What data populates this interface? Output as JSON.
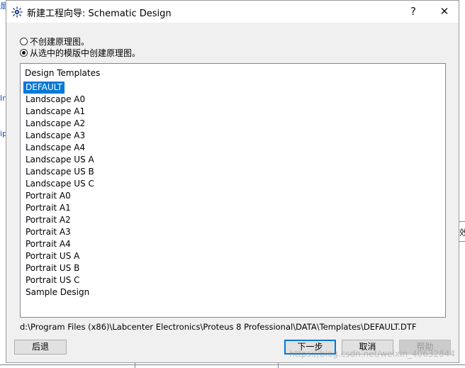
{
  "background": {
    "left_frags": [
      "是",
      "Ir",
      "ip"
    ],
    "right_cell": "效"
  },
  "dialog": {
    "title": "新建工程向导: Schematic Design",
    "help_glyph": "?",
    "close_glyph": "✕",
    "radio_options": [
      {
        "label": "不创建原理图。",
        "checked": false
      },
      {
        "label": "从选中的模版中创建原理图。",
        "checked": true
      }
    ],
    "list_header": "Design Templates",
    "templates": [
      "DEFAULT",
      "Landscape A0",
      "Landscape A1",
      "Landscape A2",
      "Landscape A3",
      "Landscape A4",
      "Landscape US A",
      "Landscape US B",
      "Landscape US C",
      "Portrait A0",
      "Portrait A1",
      "Portrait A2",
      "Portrait A3",
      "Portrait A4",
      "Portrait US A",
      "Portrait US B",
      "Portrait US C",
      "Sample Design"
    ],
    "selected_template": "DEFAULT",
    "template_path": "d:\\Program Files (x86)\\Labcenter Electronics\\Proteus 8 Professional\\DATA\\Templates\\DEFAULT.DTF",
    "buttons": {
      "back": "后退",
      "next": "下一步",
      "cancel": "取消",
      "help": "帮助"
    }
  },
  "watermark": "https://blog.csdn.net/weixin_40632844"
}
